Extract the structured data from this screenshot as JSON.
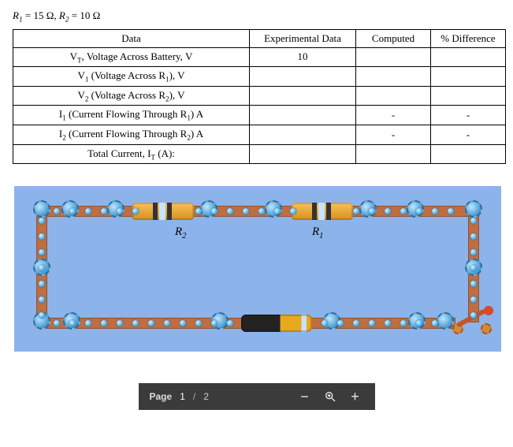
{
  "params": {
    "r1_label": "R",
    "r1_sub": "1",
    "r1_val": " = 15 Ω, ",
    "r2_label": "R",
    "r2_sub": "2",
    "r2_val": " = 10 Ω"
  },
  "table": {
    "headers": {
      "data": "Data",
      "exp": "Experimental Data",
      "comp": "Computed",
      "diff": "% Difference"
    },
    "rows": [
      {
        "label_html": "V<sub>T</sub>, Voltage Across Battery, V",
        "exp": "10",
        "comp": "",
        "diff": ""
      },
      {
        "label_html": "V<sub>1</sub> (Voltage Across R<sub>1</sub>), V",
        "exp": "",
        "comp": "",
        "diff": ""
      },
      {
        "label_html": "V<sub>2</sub> (Voltage Across R<sub>2</sub>), V",
        "exp": "",
        "comp": "",
        "diff": ""
      },
      {
        "label_html": "I<sub>1</sub> (Current Flowing Through R<sub>1</sub>) A",
        "exp": "",
        "comp": "-",
        "diff": "-"
      },
      {
        "label_html": "I<sub>2</sub> (Current Flowing Through R<sub>2</sub>) A",
        "exp": "",
        "comp": "-",
        "diff": "-"
      },
      {
        "label_html": "Total Current, I<sub>T</sub> (A):",
        "exp": "",
        "comp": "",
        "diff": ""
      }
    ]
  },
  "circuit": {
    "r1_label": "R",
    "r1_sub": "1",
    "r2_label": "R",
    "r2_sub": "2"
  },
  "toolbar": {
    "page_label": "Page",
    "current": "1",
    "slash": "/",
    "total": "2"
  }
}
